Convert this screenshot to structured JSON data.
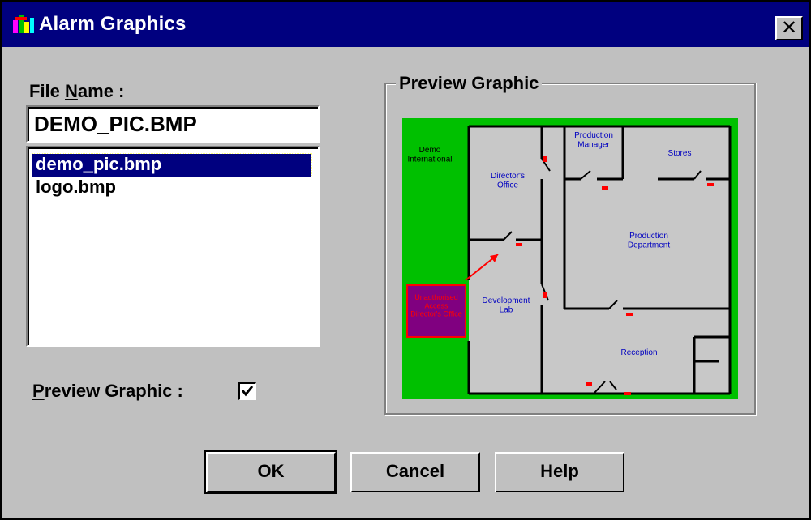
{
  "window": {
    "title": "Alarm Graphics",
    "close_glyph": "✕"
  },
  "file_name": {
    "label_prefix": "File ",
    "label_hotkey": "N",
    "label_suffix": "ame :",
    "value": "DEMO_PIC.BMP"
  },
  "file_list": {
    "items": [
      "demo_pic.bmp",
      "logo.bmp"
    ],
    "selected_index": 0
  },
  "preview_option": {
    "label_hotkey": "P",
    "label_rest": "review Graphic :",
    "checked": true
  },
  "preview_group": {
    "title": "Preview Graphic",
    "rooms": {
      "company": "Demo\nInternational",
      "directors": "Director's\nOffice",
      "prod_manager": "Production\nManager",
      "stores": "Stores",
      "prod_dept": "Production\nDepartment",
      "dev_lab": "Development\nLab",
      "reception": "Reception",
      "alert": "Unauthorised\nAccess\nDirector's Office"
    }
  },
  "buttons": {
    "ok": "OK",
    "cancel": "Cancel",
    "help": "Help"
  },
  "colors": {
    "titlebar": "#00007f",
    "face": "#c0c0c0",
    "floor": "#c8c8c8",
    "grass": "#00c000",
    "alarm": "#ff0000",
    "alert_box": "#800080"
  }
}
